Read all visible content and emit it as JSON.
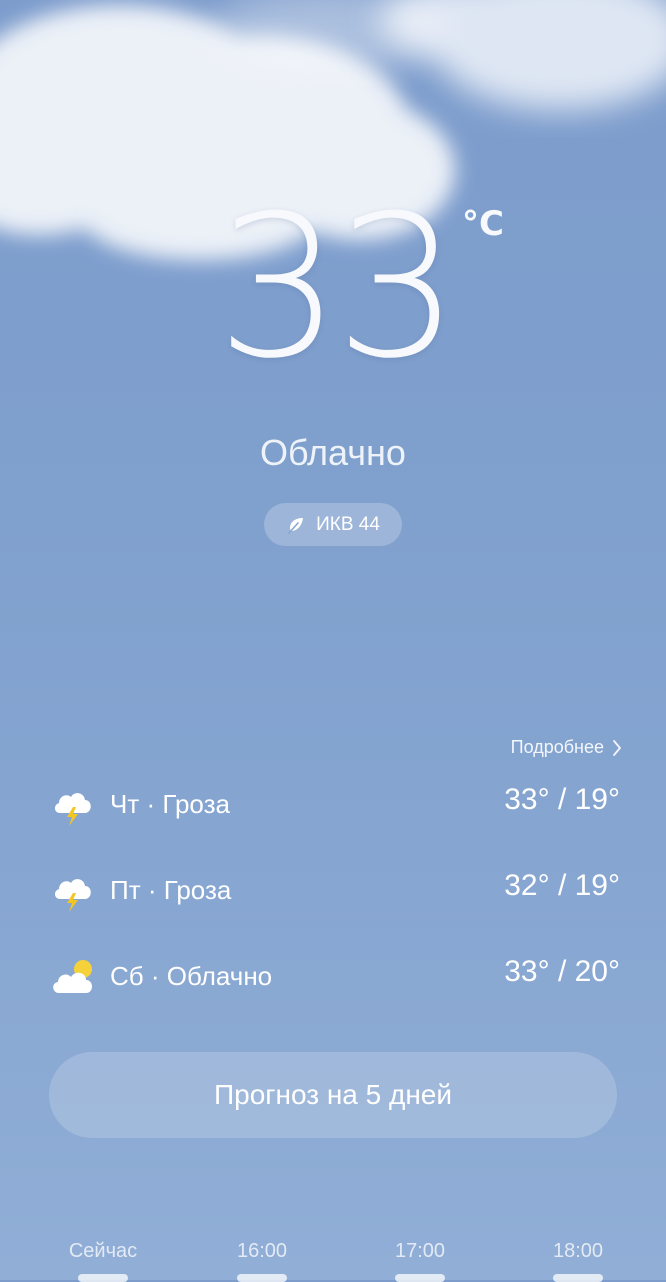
{
  "current": {
    "temperature": "33",
    "unit": "°C",
    "condition": "Облачно",
    "aqi_label": "ИКВ 44"
  },
  "forecast": {
    "more_label": "Подробнее",
    "days": [
      {
        "label": "Чт · Гроза",
        "range": "33° / 19°",
        "icon": "thunderstorm-icon"
      },
      {
        "label": "Пт · Гроза",
        "range": "32° / 19°",
        "icon": "thunderstorm-icon"
      },
      {
        "label": "Сб · Облачно",
        "range": "33° / 20°",
        "icon": "partly-cloudy-icon"
      }
    ],
    "button_label": "Прогноз на 5 дней"
  },
  "hourly": {
    "times": [
      "Сейчас",
      "16:00",
      "17:00",
      "18:00"
    ]
  },
  "colors": {
    "sky_top": "#7d9ccc",
    "sky_bottom": "#90aed6",
    "bolt": "#f3c623",
    "sun": "#f5d23a"
  }
}
